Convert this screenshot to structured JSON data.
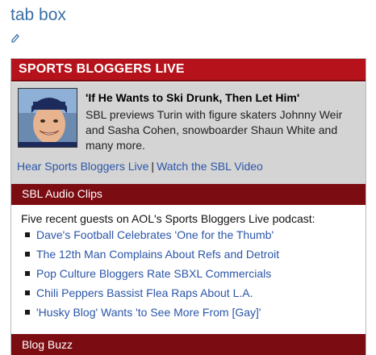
{
  "page": {
    "title": "tab box",
    "title_icon": "edit-icon"
  },
  "widget": {
    "header": "SPORTS BLOGGERS LIVE",
    "feature": {
      "photo_icon": "athlete-photo",
      "title": "'If He Wants to Ski Drunk, Then Let Him'",
      "description": "SBL previews Turin with figure skaters Johnny Weir and Sasha Cohen, snowboarder Shaun White and many more.",
      "link_audio": "Hear Sports Bloggers Live",
      "separator": "|",
      "link_video": "Watch the SBL Video"
    },
    "audio_clips": {
      "heading": "SBL Audio Clips",
      "intro": "Five recent guests on AOL's Sports Bloggers Live podcast:",
      "items": [
        "Dave's Football Celebrates 'One for the Thumb'",
        "The 12th Man Complains About Refs and Detroit",
        "Pop Culture Bloggers Rate SBXL Commercials",
        "Chili Peppers Bassist Flea Raps About L.A.",
        "'Husky Blog' Wants 'to See More From [Gay]'"
      ]
    },
    "blog_buzz": {
      "heading": "Blog Buzz"
    }
  },
  "colors": {
    "header_red": "#b5121b",
    "bar_dark_red": "#7b0c12",
    "link_blue": "#2b56a8",
    "title_blue": "#3a6ea5",
    "feature_gray": "#d4d4d4"
  }
}
